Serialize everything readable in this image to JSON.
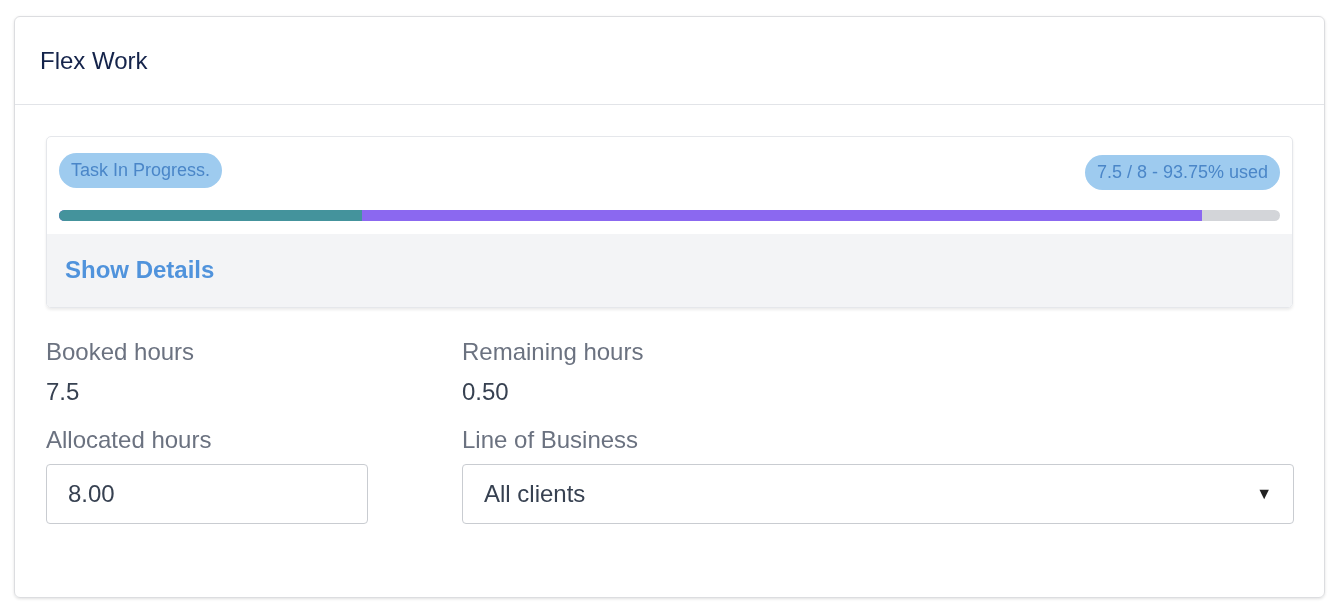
{
  "card": {
    "title": "Flex Work"
  },
  "progress": {
    "status_badge": "Task In Progress.",
    "usage_badge": "7.5 / 8 - 93.75% used",
    "segments": [
      {
        "level": 0.248,
        "color": "#44939c"
      },
      {
        "level": 0.936,
        "color": "#8b68f0"
      }
    ],
    "details_link": "Show Details"
  },
  "stats": [
    {
      "label": "Booked hours",
      "value": "7.5"
    },
    {
      "label": "Remaining hours",
      "value": "0.50"
    }
  ],
  "fields": [
    {
      "kind": "input",
      "label": "Allocated hours",
      "value": "8.00"
    },
    {
      "kind": "select",
      "label": "Line of Business",
      "value": "All clients",
      "caret": "▼"
    }
  ]
}
